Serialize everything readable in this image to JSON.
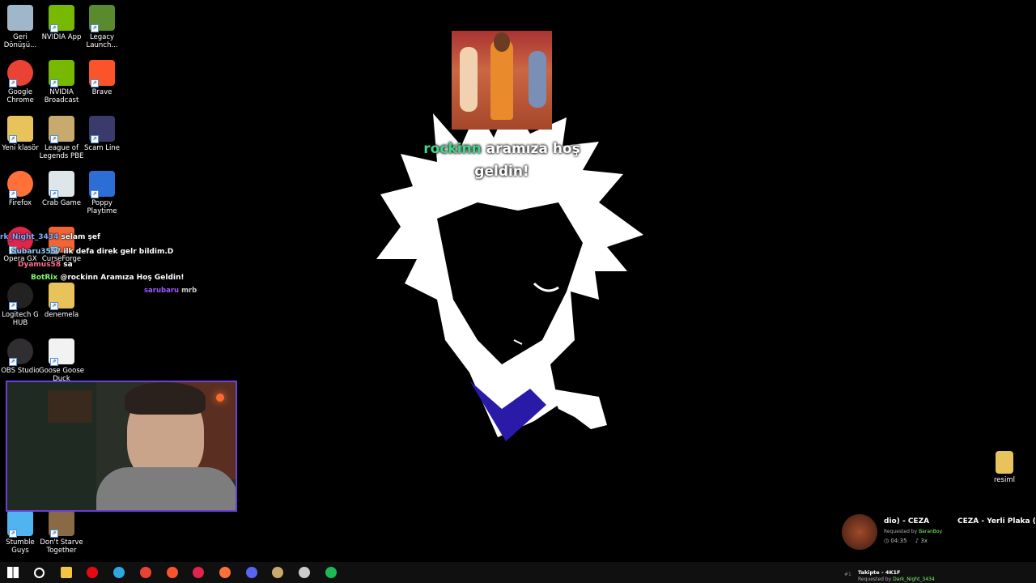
{
  "desktop_icons": [
    {
      "label": "Geri Dönüşü...",
      "icon": "recycle-bin-icon",
      "color": "#9fb7c9"
    },
    {
      "label": "NVIDIA App",
      "icon": "nvidia-icon",
      "color": "#76b900"
    },
    {
      "label": "Legacy Launch...",
      "icon": "minecraft-icon",
      "color": "#5a8a2e"
    },
    {
      "label": "Google Chrome",
      "icon": "chrome-icon",
      "color": "#ea4335"
    },
    {
      "label": "NVIDIA Broadcast",
      "icon": "nvidia-broadcast-icon",
      "color": "#76b900"
    },
    {
      "label": "Brave",
      "icon": "brave-icon",
      "color": "#fb542b"
    },
    {
      "label": "Yeni klasör",
      "icon": "folder-icon",
      "color": "#e8c25a"
    },
    {
      "label": "League of Legends PBE",
      "icon": "league-icon",
      "color": "#c8aa6e"
    },
    {
      "label": "Scam Line",
      "icon": "scam-line-icon",
      "color": "#3b3b6b"
    },
    {
      "label": "Firefox",
      "icon": "firefox-icon",
      "color": "#ff7139"
    },
    {
      "label": "Crab Game",
      "icon": "crab-game-icon",
      "color": "#dfe6ea"
    },
    {
      "label": "Poppy Playtime",
      "icon": "poppy-playtime-icon",
      "color": "#2d6dd6"
    },
    {
      "label": "Opera GX",
      "icon": "opera-gx-icon",
      "color": "#e0254b"
    },
    {
      "label": "CurseForge",
      "icon": "curseforge-icon",
      "color": "#f16436"
    },
    {
      "label": "Logitech G HUB",
      "icon": "logitech-icon",
      "color": "#222222"
    },
    {
      "label": "denemela",
      "icon": "folder-icon",
      "color": "#e8c25a"
    },
    {
      "label": "OBS Studio",
      "icon": "obs-icon",
      "color": "#302e31"
    },
    {
      "label": "Goose Goose Duck",
      "icon": "goose-icon",
      "color": "#f2f2f2"
    },
    {
      "label": "Stumble Guys",
      "icon": "stumble-guys-icon",
      "color": "#4fb4f0"
    },
    {
      "label": "Don't Starve Together",
      "icon": "dont-starve-icon",
      "color": "#8a6a45"
    }
  ],
  "right_icon": {
    "label": "resiml",
    "icon": "folder-icon",
    "color": "#e8c25a"
  },
  "chat": [
    {
      "user": "rk_Night_3434",
      "text": "selam şef",
      "color": "#7fb0ff"
    },
    {
      "user": "Subaru3557",
      "text": "ilk defa direk gelr bildim.D",
      "color": "#8fd3ff"
    },
    {
      "user": "Dyamus58",
      "text": "sa",
      "color": "#ff6b8a"
    },
    {
      "user": "BotRix",
      "text": "@rockinn Aramıza Hoş Geldin!",
      "color": "#7cfc6a"
    },
    {
      "user": "sarubaru",
      "text": "mrb",
      "color": "#9b59ff"
    }
  ],
  "alert": {
    "user": "rockinn",
    "message": "aramıza hoş geldin!",
    "user_color": "#3dd68c"
  },
  "now_playing": {
    "title": "dio) - CEZA",
    "scroll_title": "CEZA - Yerli Plaka (",
    "requested_prefix": "Requested by",
    "requested_by": "BaranBoy",
    "time": "04:35",
    "repeat": "3x"
  },
  "follow_bar": {
    "rank": "#1",
    "text": "Takipte - 4K1F",
    "requested_prefix": "Requested by",
    "requested_by": "Dark_Night_3434"
  },
  "taskbar": [
    {
      "icon": "windows-start-icon",
      "color": "#ffffff"
    },
    {
      "icon": "search-icon",
      "color": "#ffffff"
    },
    {
      "icon": "file-explorer-icon",
      "color": "#f4c542"
    },
    {
      "icon": "netflix-icon",
      "color": "#e50914"
    },
    {
      "icon": "edge-icon",
      "color": "#2fa7e0"
    },
    {
      "icon": "chrome-icon",
      "color": "#ea4335"
    },
    {
      "icon": "brave-icon",
      "color": "#fb542b"
    },
    {
      "icon": "opera-icon",
      "color": "#e0254b"
    },
    {
      "icon": "firefox-icon",
      "color": "#ff7139"
    },
    {
      "icon": "discord-icon",
      "color": "#5865f2"
    },
    {
      "icon": "league-icon",
      "color": "#c8aa6e"
    },
    {
      "icon": "obs-icon",
      "color": "#cccccc"
    },
    {
      "icon": "spotify-icon",
      "color": "#1db954"
    }
  ]
}
